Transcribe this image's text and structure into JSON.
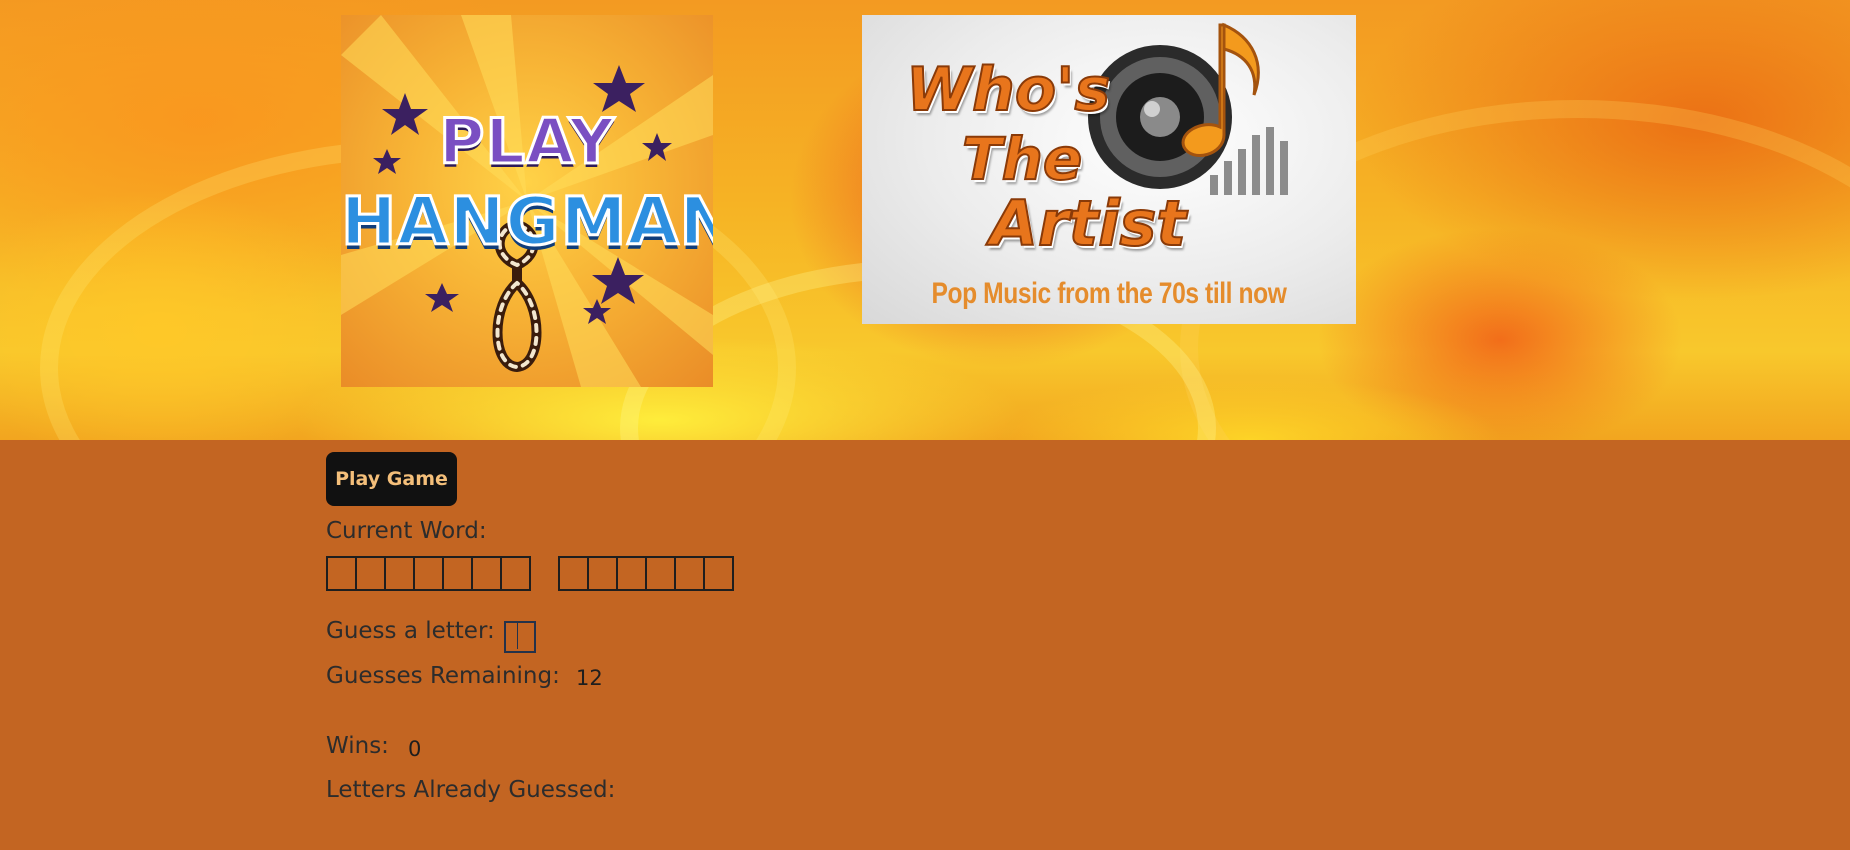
{
  "hero": {
    "hangman_logo": {
      "line1": "PLAY",
      "line2": "HANGMAN"
    },
    "artist_logo": {
      "line1": "Who's",
      "line2": "The",
      "line3": "Artist",
      "tagline": "Pop Music from the 70s till now"
    }
  },
  "game": {
    "play_button_label": "Play Game",
    "current_word_label": "Current Word:",
    "word_groups": [
      7,
      6
    ],
    "guess_label": "Guess a letter:",
    "guess_value": "",
    "guesses_remaining_label": "Guesses Remaining:",
    "guesses_remaining_value": "12",
    "wins_label": "Wins:",
    "wins_value": "0",
    "letters_guessed_label": "Letters Already Guessed:",
    "letters_guessed_value": ""
  },
  "colors": {
    "page_background": "#c36522",
    "button_background": "#111111",
    "button_text": "#f4bf7a",
    "text": "#2c2c2c"
  }
}
